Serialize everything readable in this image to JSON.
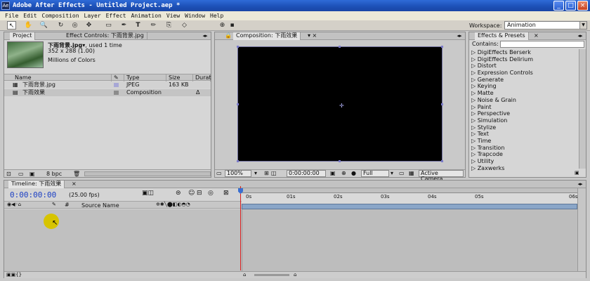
{
  "window": {
    "title": "Adobe After Effects - Untitled Project.aep *",
    "icon": "ae-icon"
  },
  "window_buttons": {
    "minimize": "_",
    "maximize": "□",
    "close": "×"
  },
  "menu": [
    "File",
    "Edit",
    "Composition",
    "Layer",
    "Effect",
    "Animation",
    "View",
    "Window",
    "Help"
  ],
  "toolbar": {
    "tools": [
      "selection-tool",
      "hand-tool",
      "zoom-tool",
      "rotate-tool",
      "orbit-camera-tool",
      "track-xy-tool",
      "track-z-tool",
      "pan-behind-tool",
      "rectangle-mask-tool",
      "pen-tool",
      "type-tool",
      "brush-tool",
      "clone-stamp-tool",
      "eraser-tool"
    ],
    "tool_glyphs": [
      "↖",
      "✋",
      "🔍",
      "↻",
      "◎",
      "✥",
      "✥",
      "⊞",
      "▭",
      "✒",
      "T",
      "✏",
      "⎘",
      "◇"
    ],
    "workspace_label": "Workspace:",
    "workspace_value": "Animation"
  },
  "project": {
    "tabs": [
      "Project",
      "Effect Controls: 下雨背景.jpg"
    ],
    "item_name": "下雨背景.jpg",
    "item_usage": "▾, used 1 time",
    "item_dims": "352 x 288 (1.00)",
    "item_colors": "Millions of Colors",
    "columns": [
      "Name",
      "Type",
      "Size",
      "Durat"
    ],
    "rows": [
      {
        "name": "下雨背景.jpg",
        "type": "JPEG",
        "size": "163 KB",
        "duration": "",
        "label_color": "#a7a7d6"
      },
      {
        "name": "下雨效果",
        "type": "Composition",
        "size": "",
        "duration": "Δ",
        "label_color": "#8c8c8c"
      }
    ],
    "footer_bpc": "8 bpc"
  },
  "composition": {
    "tab": "Composition: 下雨效果",
    "zoom": "100%",
    "timecode": "0:00:00:00",
    "resolution": "Full",
    "camera": "Active Camera"
  },
  "effects": {
    "tab": "Effects & Presets",
    "contains_label": "Contains:",
    "items": [
      "DigiEffects Berserk",
      "DigiEffects Delirium",
      "Distort",
      "Expression Controls",
      "Generate",
      "Keying",
      "Matte",
      "Noise & Grain",
      "Paint",
      "Perspective",
      "Simulation",
      "Stylize",
      "Text",
      "Time",
      "Transition",
      "Trapcode",
      "Utility",
      "Zaxwerks"
    ]
  },
  "timeline": {
    "tab": "Timeline: 下雨效果",
    "current_time": "0:00:00:00",
    "fps": "(25.00 fps)",
    "source_name_header": "Source Name",
    "ruler_ticks": [
      "0s",
      "01s",
      "02s",
      "03s",
      "04s",
      "05s",
      "06s"
    ]
  }
}
